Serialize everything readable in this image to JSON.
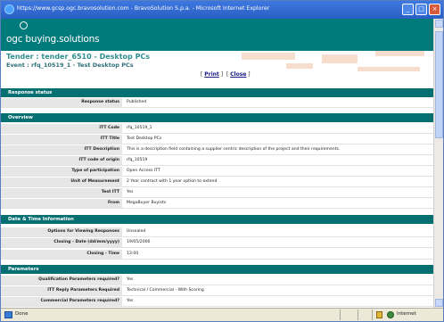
{
  "window": {
    "title": "https://www.gcsp.ogc.bravosolution.com - BravoSolution S.p.a. - Microsoft Internet Explorer",
    "buttons": [
      "_",
      "□",
      "×"
    ],
    "close_color": "#d85a3c"
  },
  "brand": {
    "logo_text": "ogc buying.solutions",
    "color": "#007a7a"
  },
  "header": {
    "title": "Tender : tender_6510 - Desktop PCs",
    "event": "Event : rfq_10519_1 - Test Desktop PCs",
    "print_label": "Print",
    "close_label": "Close"
  },
  "sections": {
    "response_status": {
      "heading": "Response status",
      "rows": [
        {
          "label": "Response status",
          "value": "Published"
        }
      ]
    },
    "overview": {
      "heading": "Overview",
      "rows": [
        {
          "label": "ITT Code",
          "value": "rfq_10519_1"
        },
        {
          "label": "ITT Title",
          "value": "Test Desktop PCs"
        },
        {
          "label": "ITT Description",
          "value": "This is a description field containing a supplier centric description of the project and their requirements."
        },
        {
          "label": "ITT code of origin",
          "value": "rfq_10519"
        },
        {
          "label": "Type of participation",
          "value": "Open Access ITT"
        },
        {
          "label": "Unit of Measurement",
          "value": "2 Year contract with 1 year option to extend"
        },
        {
          "label": "Test ITT",
          "value": "Yes"
        },
        {
          "label": "From",
          "value": "MegaBuyer Buyists"
        }
      ]
    },
    "date_time": {
      "heading": "Date & Time Information",
      "rows": [
        {
          "label": "Options for Viewing Responses",
          "value": "Unsealed"
        },
        {
          "label": "Closing - Date (dd/mm/yyyy)",
          "value": "19/05/2006"
        },
        {
          "label": "Closing - Time",
          "value": "13:00"
        }
      ]
    },
    "parameters": {
      "heading": "Parameters",
      "rows": [
        {
          "label": "Qualification Parameters required?",
          "value": "Yes"
        },
        {
          "label": "ITT Reply Parameters Required",
          "value": "Technical / Commercial - With Scoring"
        },
        {
          "label": "Commercial Parameters required?",
          "value": "Yes"
        }
      ]
    }
  },
  "statusbar": {
    "status": "Done",
    "zone": "Internet"
  }
}
